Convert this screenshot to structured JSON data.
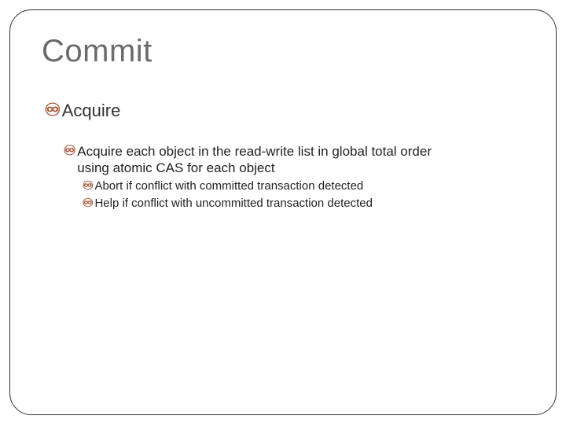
{
  "title": "Commit",
  "bullets": {
    "l1": {
      "text": "Acquire"
    },
    "l2": {
      "line1": "Acquire each object in the read-write list in global total order",
      "line2": "using atomic CAS for each object"
    },
    "l3a": {
      "text": "Abort if conflict with committed transaction detected"
    },
    "l3b": {
      "text": "Help if conflict with uncommitted transaction detected"
    }
  },
  "marker": "་"
}
